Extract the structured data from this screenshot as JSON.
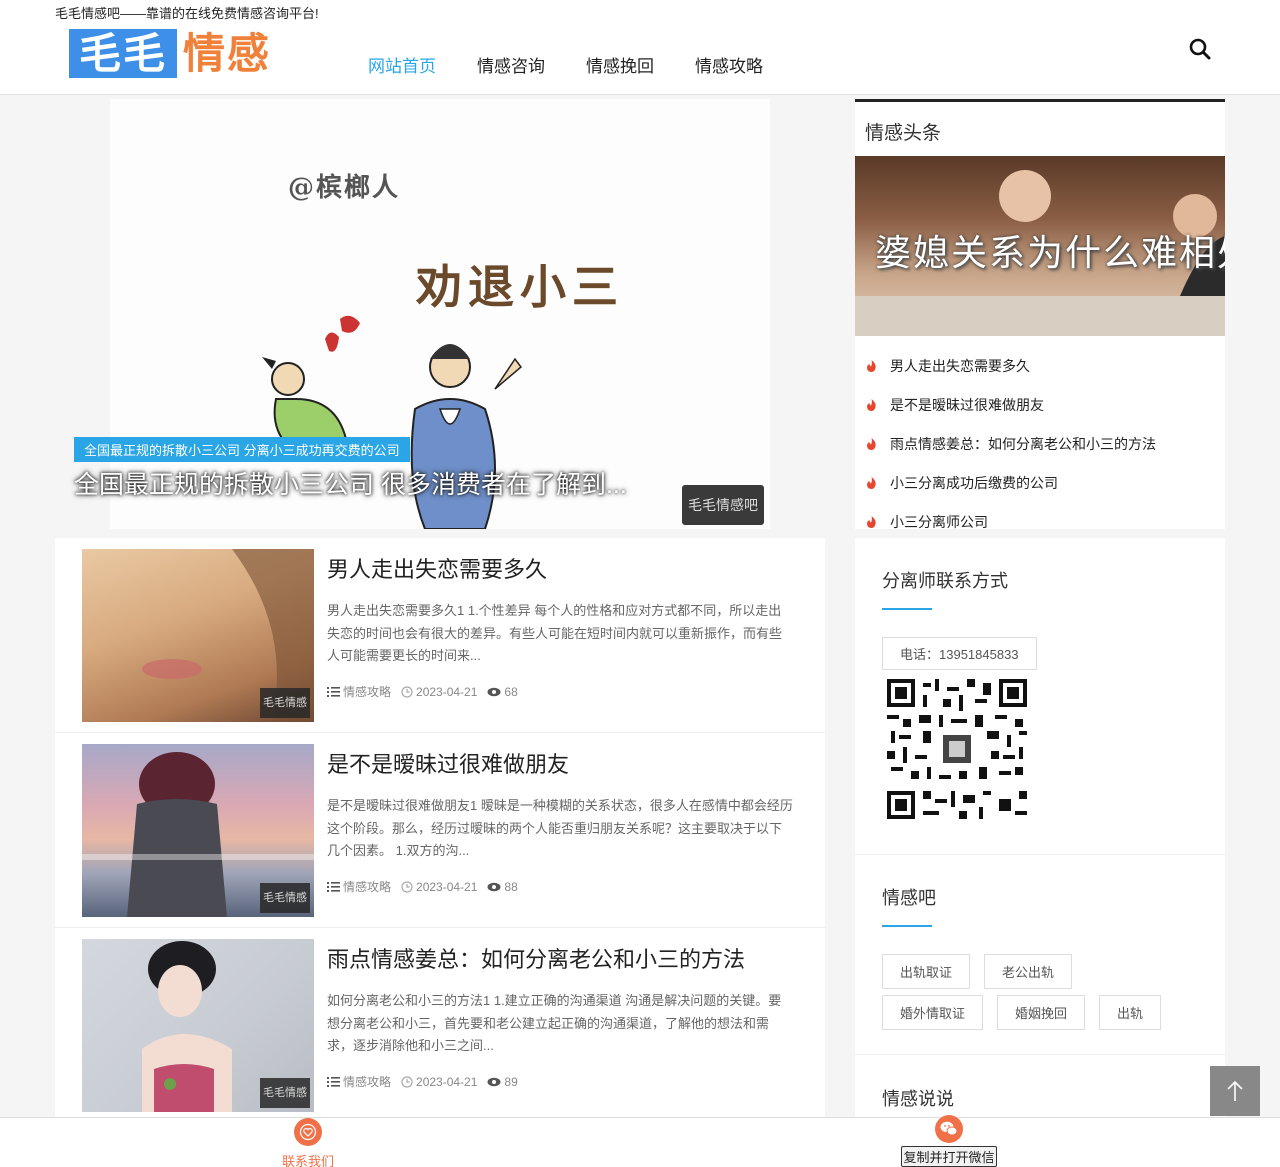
{
  "site": {
    "tagline": "毛毛情感吧——靠谱的在线免费情感咨询平台!",
    "logo_part1": "毛毛",
    "logo_part2": "情感"
  },
  "nav": {
    "items": [
      "网站首页",
      "情感咨询",
      "情感挽回",
      "情感攻略"
    ],
    "active_color": "#2aa6e6"
  },
  "slider": {
    "image_text_small": "@槟榔人",
    "image_text_big": "劝退小三",
    "tag": "全国最正规的拆散小三公司 分离小三成功再交费的公司",
    "title": "全国最正规的拆散小三公司 很多消费者在了解到..."
  },
  "articles": [
    {
      "title": "男人走出失恋需要多久",
      "excerpt": "男人走出失恋需要多久1 1.个性差异 每个人的性格和应对方式都不同，所以走出失恋的时间也会有很大的差异。有些人可能在短时间内就可以重新振作，而有些人可能需要更长的时间来...",
      "category": "情感攻略",
      "date": "2023-04-21",
      "views": "68"
    },
    {
      "title": "是不是暧昧过很难做朋友",
      "excerpt": "是不是暧昧过很难做朋友1 暧昧是一种模糊的关系状态，很多人在感情中都会经历这个阶段。那么，经历过暧昧的两个人能否重归朋友关系呢？这主要取决于以下几个因素。 1.双方的沟...",
      "category": "情感攻略",
      "date": "2023-04-21",
      "views": "88"
    },
    {
      "title": "雨点情感姜总：如何分离老公和小三的方法",
      "excerpt": "如何分离老公和小三的方法1 1.建立正确的沟通渠道 沟通是解决问题的关键。要想分离老公和小三，首先要和老公建立起正确的沟通渠道，了解他的想法和需求，逐步消除他和小三之间...",
      "category": "情感攻略",
      "date": "2023-04-21",
      "views": "89"
    }
  ],
  "sidebar": {
    "hot_title": "情感头条",
    "hot_image_caption": "婆媳关系为什么难相处",
    "hot_items": [
      "男人走出失恋需要多久",
      "是不是暧昧过很难做朋友",
      "雨点情感姜总：如何分离老公和小三的方法",
      "小三分离成功后缴费的公司",
      "小三分离师公司"
    ],
    "contact_title": "分离师联系方式",
    "phone": "电话：13951845833",
    "tags_title": "情感吧",
    "tags": [
      "出轨取证",
      "老公出轨",
      "婚外情取证",
      "婚姻挽回",
      "出轨"
    ],
    "talk_title": "情感说说"
  },
  "bottom_bar": {
    "contact_label": "联系我们",
    "wechat_label": "复制并打开微信"
  },
  "colors": {
    "accent": "#2aa6e6",
    "logo_blue": "#3d8fe8",
    "logo_orange": "#f0813a",
    "hot_icon": "#e8452e"
  }
}
